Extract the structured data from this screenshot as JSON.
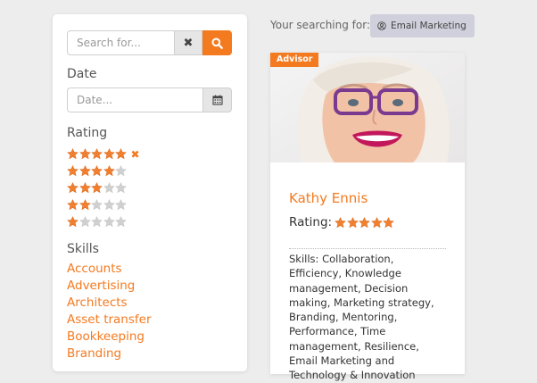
{
  "filters": {
    "search": {
      "placeholder": "Search for...",
      "value": ""
    },
    "date": {
      "label": "Date",
      "placeholder": "Date...",
      "value": ""
    },
    "rating": {
      "label": "Rating",
      "options": [
        {
          "stars": 5,
          "max": 5,
          "selected": true
        },
        {
          "stars": 4,
          "max": 5,
          "selected": false
        },
        {
          "stars": 3,
          "max": 5,
          "selected": false
        },
        {
          "stars": 2,
          "max": 5,
          "selected": false
        },
        {
          "stars": 1,
          "max": 5,
          "selected": false
        }
      ]
    },
    "skills": {
      "label": "Skills",
      "items": [
        "Accounts",
        "Advertising",
        "Architects",
        "Asset transfer",
        "Bookkeeping",
        "Branding"
      ]
    }
  },
  "search_header": {
    "label": "Your searching for:",
    "tag": "Email Marketing"
  },
  "advisor_card": {
    "badge": "Advisor",
    "name": "Kathy Ennis",
    "rating_label": "Rating:",
    "rating": 5,
    "skills_text": "Skills: Collaboration, Efficiency, Knowledge management, Decision making, Marketing strategy, Branding, Mentoring, Performance, Time management, Resilience, Email Marketing and Technology & Innovation"
  },
  "colors": {
    "accent": "#f47a20",
    "star_filled": "#f08030",
    "star_empty": "#d0d0d0",
    "tag_bg": "#cfd0db",
    "page_bg": "#ededed"
  },
  "icons": {
    "search_button": "search-icon",
    "clear_button": "close-icon",
    "date_button": "calendar-icon",
    "tag": "user-icon"
  }
}
